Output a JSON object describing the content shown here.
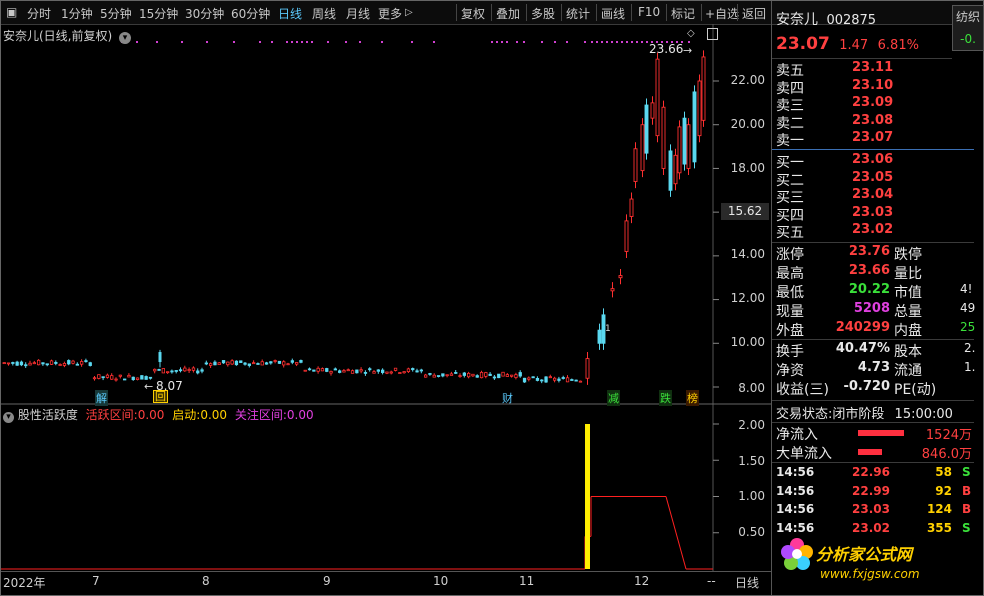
{
  "toolbar": {
    "tabs": [
      "分时",
      "1分钟",
      "5分钟",
      "15分钟",
      "30分钟",
      "60分钟",
      "日线",
      "周线",
      "月线",
      "更多"
    ],
    "more_arrow": "▷",
    "active_tab": "日线",
    "tools": [
      "复权",
      "叠加",
      "多股",
      "统计",
      "画线",
      "F10",
      "标记",
      "+自选",
      "返回"
    ]
  },
  "main": {
    "title": "安奈儿(日线,前复权)",
    "price_labels": [
      "22.00",
      "20.00",
      "18.00",
      "16.00",
      "14.00",
      "12.00",
      "10.00",
      "8.00"
    ],
    "current_price_tag": "15.62",
    "high_label": "23.66",
    "low_label": "8.07",
    "markers": [
      {
        "text": "解",
        "color": "#5ac8fa"
      },
      {
        "text": "回",
        "color": "#ffd000"
      },
      {
        "text": "财",
        "color": "#5ac8fa"
      },
      {
        "text": "减",
        "color": "#3ae03a"
      },
      {
        "text": "跌",
        "color": "#3ae03a"
      },
      {
        "text": "榜",
        "color": "#ffd000"
      }
    ],
    "small_mark": "1"
  },
  "sub": {
    "title": "股性活跃度",
    "l1_label": "活跃区间:",
    "l1_val": "0.00",
    "l1_color": "#ff4040",
    "l2_label": "启动:",
    "l2_val": "0.00",
    "l2_color": "#ffd000",
    "l3_label": "关注区间:",
    "l3_val": "0.00",
    "l3_color": "#e040e0",
    "axis_labels": [
      "2.00",
      "1.50",
      "1.00",
      "0.50"
    ]
  },
  "xaxis": {
    "labels": [
      "2022年",
      "7",
      "8",
      "9",
      "10",
      "11",
      "12",
      "--"
    ],
    "period": "日线"
  },
  "panel": {
    "name": "安奈儿",
    "code": "002875",
    "tag": "纺织",
    "price": "23.07",
    "change": "1.47",
    "pct": "6.81%",
    "extra": "-0.",
    "sells": [
      {
        "l": "卖五",
        "p": "23.11"
      },
      {
        "l": "卖四",
        "p": "23.10"
      },
      {
        "l": "卖三",
        "p": "23.09"
      },
      {
        "l": "卖二",
        "p": "23.08"
      },
      {
        "l": "卖一",
        "p": "23.07"
      }
    ],
    "buys": [
      {
        "l": "买一",
        "p": "23.06"
      },
      {
        "l": "买二",
        "p": "23.05"
      },
      {
        "l": "买三",
        "p": "23.04"
      },
      {
        "l": "买四",
        "p": "23.03"
      },
      {
        "l": "买五",
        "p": "23.02"
      }
    ],
    "stats": [
      {
        "l": "涨停",
        "v": "23.76",
        "c": "red",
        "l2": "跌停",
        "v2": ""
      },
      {
        "l": "最高",
        "v": "23.66",
        "c": "red",
        "l2": "量比",
        "v2": ""
      },
      {
        "l": "最低",
        "v": "20.22",
        "c": "green",
        "l2": "市值",
        "v2": "4!"
      },
      {
        "l": "现量",
        "v": "5208",
        "c": "purple",
        "l2": "总量",
        "v2": "49"
      },
      {
        "l": "外盘",
        "v": "240299",
        "c": "red",
        "l2": "内盘",
        "v2": "25"
      }
    ],
    "stats2": [
      {
        "l": "换手",
        "v": "40.47%",
        "l2": "股本",
        "v2": "2."
      },
      {
        "l": "净资",
        "v": "4.73",
        "l2": "流通",
        "v2": "1."
      },
      {
        "l": "收益(三)",
        "v": "-0.720",
        "l2": "PE(动)",
        "v2": ""
      }
    ],
    "trade_state_label": "交易状态:",
    "trade_state": "闭市阶段",
    "trade_time": "15:00:00",
    "flows": [
      {
        "l": "净流入",
        "v": "1524万"
      },
      {
        "l": "大单流入",
        "v": "846.0万"
      }
    ],
    "ticks": [
      {
        "t": "14:56",
        "p": "22.96",
        "pc": "red",
        "v": "58",
        "s": "S",
        "sc": "green"
      },
      {
        "t": "14:56",
        "p": "22.99",
        "pc": "red",
        "v": "92",
        "s": "B",
        "sc": "red"
      },
      {
        "t": "14:56",
        "p": "23.03",
        "pc": "red",
        "v": "124",
        "s": "B",
        "sc": "red"
      },
      {
        "t": "14:56",
        "p": "23.02",
        "pc": "red",
        "v": "355",
        "s": "S",
        "sc": "green"
      }
    ],
    "logo_text": "分析家公式网",
    "logo_url": "www.fxjgsw.com"
  }
}
